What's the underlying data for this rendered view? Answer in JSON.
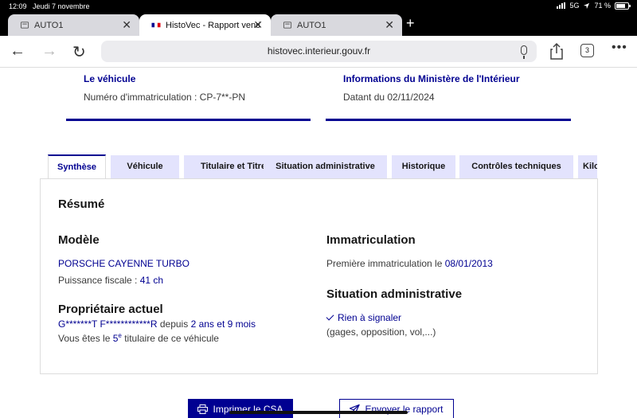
{
  "status_bar": {
    "time": "12:09",
    "date": "Jeudi 7 novembre",
    "network": "5G",
    "battery": "71 %",
    "battery_level": 0.71
  },
  "browser": {
    "tabs": [
      {
        "label": "AUTO1"
      },
      {
        "label": "HistoVec - Rapport vendeur"
      },
      {
        "label": "AUTO1"
      }
    ],
    "url": "histovec.interieur.gouv.fr",
    "tabs_count": "3"
  },
  "cards": {
    "vehicle": {
      "title": "Le véhicule",
      "text": "Numéro d'immatriculation : CP-7**-PN"
    },
    "ministry": {
      "title": "Informations du Ministère de l'Intérieur",
      "text": "Datant du 02/11/2024"
    }
  },
  "page_tabs": [
    "Synthèse",
    "Véhicule",
    "Titulaire et Titre",
    "Situation administrative",
    "Historique",
    "Contrôles techniques",
    "Kilo"
  ],
  "summary": {
    "title": "Résumé",
    "model": {
      "heading": "Modèle",
      "name": "PORSCHE CAYENNE TURBO",
      "power_label": "Puissance fiscale :",
      "power_value": "41 ch"
    },
    "owner": {
      "heading": "Propriétaire actuel",
      "name": "G*******T F************R",
      "since_label": "depuis",
      "since_value": "2 ans et 9 mois",
      "rank_prefix": "Vous êtes le",
      "rank": "5",
      "rank_sup": "e",
      "rank_suffix": "titulaire de ce véhicule"
    },
    "registration": {
      "heading": "Immatriculation",
      "label": "Première immatriculation le",
      "date": "08/01/2013"
    },
    "admin": {
      "heading": "Situation administrative",
      "status": "Rien à signaler",
      "details": "(gages, opposition, vol,...)"
    }
  },
  "actions": {
    "print": "Imprimer le CSA",
    "send": "Envoyer le rapport"
  }
}
